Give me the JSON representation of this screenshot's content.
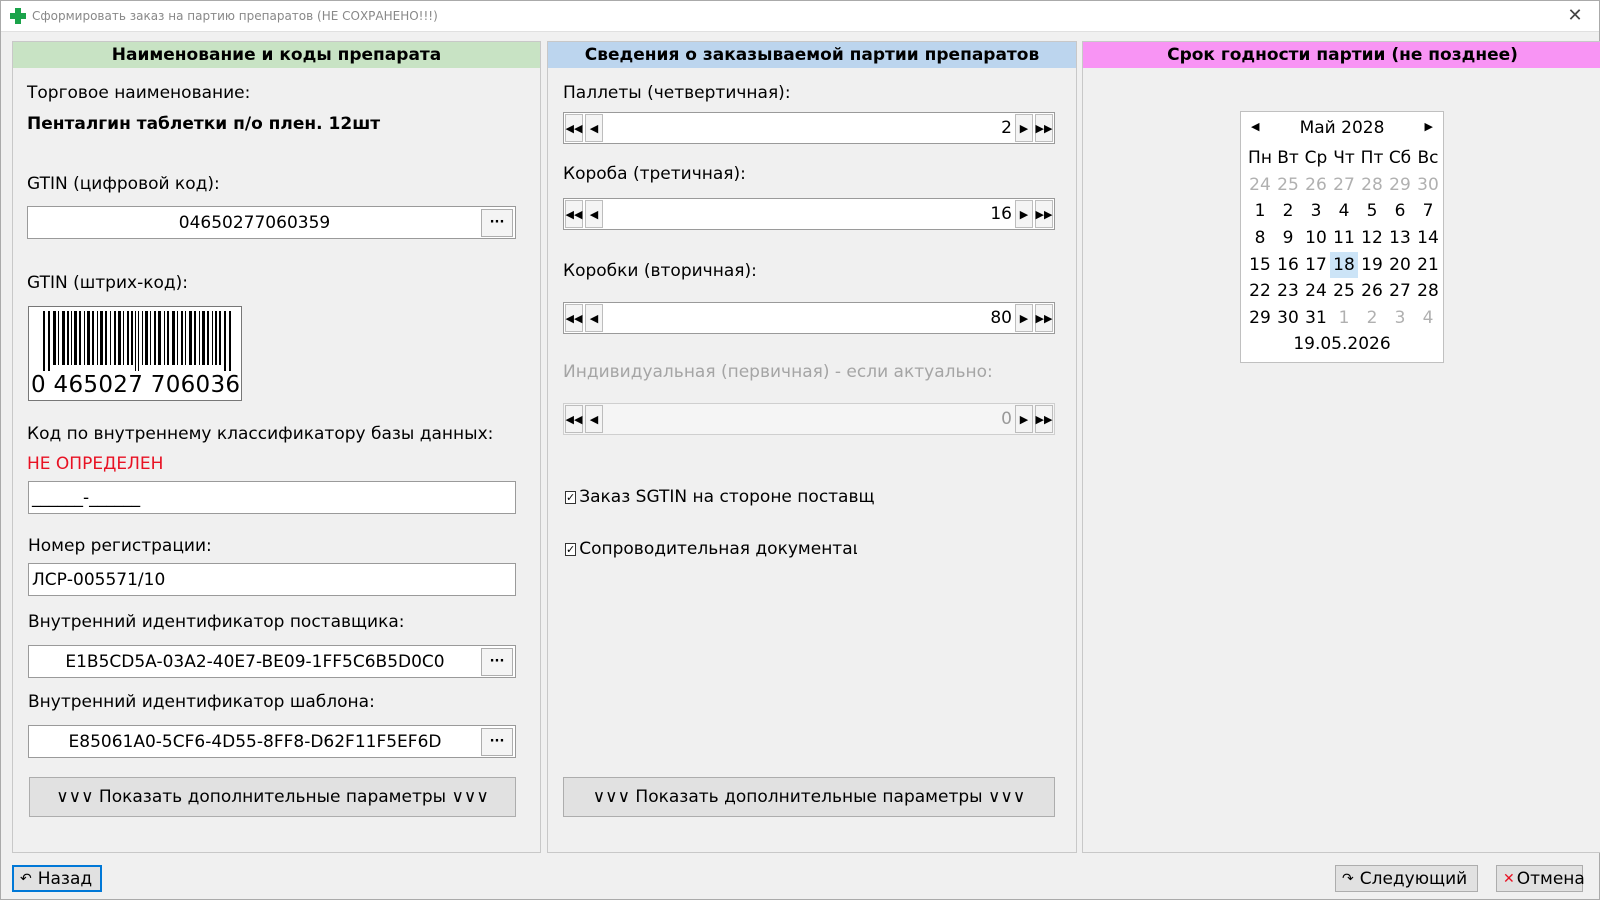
{
  "window": {
    "title": "Сформировать заказ на партию препаратов (НЕ СОХРАНЕНО!!!)"
  },
  "panel1": {
    "header": "Наименование и коды препарата",
    "trade_name_label": "Торговое наименование:",
    "trade_name_value": "Пенталгин таблетки п/о плен. 12шт",
    "gtin_digital_label": "GTIN (цифровой код):",
    "gtin_digital_value": "04650277060359",
    "gtin_barcode_label": "GTIN (штрих-код):",
    "barcode_text": "0 465027 706036",
    "db_code_label": "Код по внутреннему классификатору базы данных:",
    "db_code_status": "НЕ ОПРЕДЕЛЕН",
    "db_code_value": "______-______",
    "reg_number_label": "Номер регистрации:",
    "reg_number_value": "ЛСР-005571/10",
    "supplier_id_label": "Внутренний идентификатор поставщика:",
    "supplier_id_value": "E1B5CD5A-03A2-40E7-BE09-1FF5C6B5D0C0",
    "template_id_label": "Внутренний идентификатор шаблона:",
    "template_id_value": "E85061A0-5CF6-4D55-8FF8-D62F11F5EF6D",
    "show_more_label": "∨∨∨   Показать дополнительные параметры   ∨∨∨",
    "dots_label": "···"
  },
  "panel2": {
    "header": "Сведения о заказываемой партии препаратов",
    "pallets_label": "Паллеты (четвертичная):",
    "pallets_value": "2",
    "boxes_label": "Короба (третичная):",
    "boxes_value": "16",
    "cartons_label": "Коробки (вторичная):",
    "cartons_value": "80",
    "individual_label": "Индивидуальная (первичная) - если актуально:",
    "individual_value": "0",
    "sgtin_check_label": "Заказ SGTIN на стороне поставщи",
    "sgtin_checked": true,
    "docs_check_label": "Сопроводительная документаци",
    "docs_checked": true,
    "show_more_label": "∨∨∨   Показать дополнительные параметры   ∨∨∨"
  },
  "panel3": {
    "header": "Срок годности партии (не позднее)",
    "calendar": {
      "month_label": "Май 2028",
      "weekdays": [
        "Пн",
        "Вт",
        "Ср",
        "Чт",
        "Пт",
        "Сб",
        "Вс"
      ],
      "days": [
        {
          "d": "24",
          "m": true
        },
        {
          "d": "25",
          "m": true
        },
        {
          "d": "26",
          "m": true
        },
        {
          "d": "27",
          "m": true
        },
        {
          "d": "28",
          "m": true
        },
        {
          "d": "29",
          "m": true
        },
        {
          "d": "30",
          "m": true
        },
        {
          "d": "1"
        },
        {
          "d": "2"
        },
        {
          "d": "3"
        },
        {
          "d": "4"
        },
        {
          "d": "5"
        },
        {
          "d": "6"
        },
        {
          "d": "7"
        },
        {
          "d": "8"
        },
        {
          "d": "9"
        },
        {
          "d": "10"
        },
        {
          "d": "11"
        },
        {
          "d": "12"
        },
        {
          "d": "13"
        },
        {
          "d": "14"
        },
        {
          "d": "15"
        },
        {
          "d": "16"
        },
        {
          "d": "17"
        },
        {
          "d": "18",
          "sel": true
        },
        {
          "d": "19"
        },
        {
          "d": "20"
        },
        {
          "d": "21"
        },
        {
          "d": "22"
        },
        {
          "d": "23"
        },
        {
          "d": "24"
        },
        {
          "d": "25"
        },
        {
          "d": "26"
        },
        {
          "d": "27"
        },
        {
          "d": "28"
        },
        {
          "d": "29"
        },
        {
          "d": "30"
        },
        {
          "d": "31"
        },
        {
          "d": "1",
          "m": true
        },
        {
          "d": "2",
          "m": true
        },
        {
          "d": "3",
          "m": true
        },
        {
          "d": "4",
          "m": true
        }
      ],
      "today_label": "19.05.2026"
    }
  },
  "footer": {
    "back_label": "Назад",
    "next_label": "Следующий",
    "cancel_label": "Отмена"
  },
  "colors": {
    "panel1_header": "#c8e3c4",
    "panel2_header": "#bcd5ee",
    "panel3_header": "#f894f4",
    "status_red": "#e81123",
    "selection": "#cce4f7"
  }
}
